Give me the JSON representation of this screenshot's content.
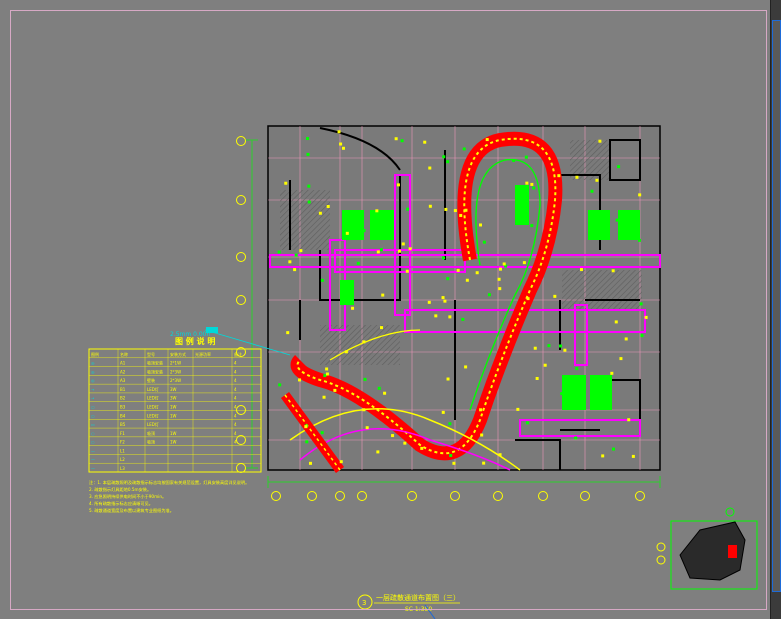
{
  "drawing": {
    "title": "一层疏散通道布置图（三）",
    "scale": "SC 1:350",
    "sheet_mark": "3"
  },
  "legend": {
    "title": "图 例 说 明",
    "callout": "2.5mm 0.00h",
    "headers": [
      "图例",
      "名称",
      "型号",
      "安装方式",
      "光源功率",
      "备注"
    ],
    "rows": [
      [
        "◎",
        "A1",
        "吸顶安装",
        "2*1W",
        "",
        "4"
      ],
      [
        "◎",
        "A2",
        "吸顶安装",
        "2*3W",
        "",
        "4"
      ],
      [
        "◎",
        "A3",
        "壁装",
        "2*3W",
        "",
        "4"
      ],
      [
        "→",
        "B1",
        "LED灯",
        "3W",
        "",
        "4"
      ],
      [
        "→",
        "B2",
        "LED灯",
        "3W",
        "",
        "4"
      ],
      [
        "▭",
        "B3",
        "LED灯",
        "1W",
        "",
        "4"
      ],
      [
        "▭",
        "B4",
        "LED灯",
        "1W",
        "",
        "4"
      ],
      [
        "▭",
        "B5",
        "LED灯",
        "",
        "",
        "4"
      ],
      [
        "○",
        "F1",
        "吸顶",
        "1W",
        "",
        "4"
      ],
      [
        "○",
        "F2",
        "吸顶",
        "1W",
        "",
        "4"
      ],
      [
        "—",
        "L1",
        "",
        "",
        "",
        ""
      ],
      [
        "—",
        "L2",
        "",
        "",
        "",
        ""
      ],
      [
        "—",
        "L3",
        "",
        "",
        "",
        ""
      ]
    ]
  },
  "notes": [
    "注：1. 本层疏散照明及疏散指示标志均按国家有关规范设置，灯具安装高度详见说明。",
    "2. 疏散指示灯具距地0.5m安装。",
    "3. 应急照明持续供电时间不小于90min。",
    "4. 所有疏散指示标志应清晰可见。",
    "5. 疏散通道宽度及布置以建筑专业图纸为准。"
  ],
  "colors": {
    "background": "#7f7f7f",
    "corridor": "#ff00ff",
    "red_zone": "#ff0000",
    "green": "#00ff00",
    "yellow": "#ffff00",
    "grid_pink": "#ff9cc4",
    "dim_green": "#2bd12b",
    "black": "#000000",
    "cyan": "#00d9d9"
  }
}
